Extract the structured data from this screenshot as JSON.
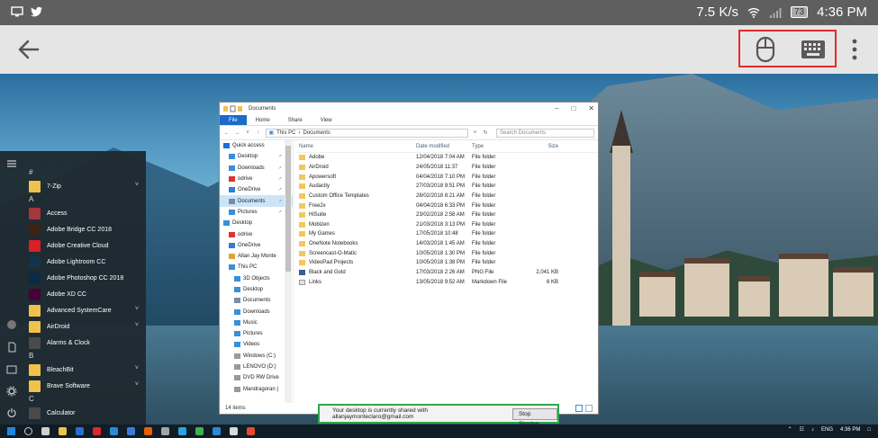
{
  "status_bar": {
    "speed": "7.5 K/s",
    "battery": "73",
    "time": "4:36 PM",
    "icons": [
      "screen-icon",
      "twitter-icon",
      "wifi-icon",
      "signal-icon",
      "battery-icon"
    ]
  },
  "app_bar": {
    "icons": [
      "back-arrow-icon",
      "mouse-icon",
      "keyboard-icon",
      "more-vert-icon"
    ],
    "highlight_color": "#e32a2a"
  },
  "start_menu": {
    "sections": [
      {
        "letter": "#",
        "items": [
          {
            "label": "7-Zip",
            "tile_color": "#f0c24b",
            "has_chevron": true
          }
        ]
      },
      {
        "letter": "A",
        "items": [
          {
            "label": "Access",
            "tile_color": "#a4373a",
            "has_chevron": false
          },
          {
            "label": "Adobe Bridge CC 2018",
            "tile_color": "#3b2414",
            "has_chevron": false
          },
          {
            "label": "Adobe Creative Cloud",
            "tile_color": "#da1f26",
            "has_chevron": false
          },
          {
            "label": "Adobe Lightroom CC",
            "tile_color": "#14324a",
            "has_chevron": false
          },
          {
            "label": "Adobe Photoshop CC 2018",
            "tile_color": "#0c2a45",
            "has_chevron": false
          },
          {
            "label": "Adobe XD CC",
            "tile_color": "#470137",
            "has_chevron": false
          },
          {
            "label": "Advanced SystemCare",
            "tile_color": "#f0c24b",
            "has_chevron": true
          },
          {
            "label": "AirDroid",
            "tile_color": "#f0c24b",
            "has_chevron": true
          },
          {
            "label": "Alarms & Clock",
            "tile_color": "#4a4a4a",
            "has_chevron": false
          }
        ]
      },
      {
        "letter": "B",
        "items": [
          {
            "label": "BleachBit",
            "tile_color": "#f0c24b",
            "has_chevron": true
          },
          {
            "label": "Brave Software",
            "tile_color": "#f0c24b",
            "has_chevron": true
          }
        ]
      },
      {
        "letter": "C",
        "items": [
          {
            "label": "Calculator",
            "tile_color": "#4a4a4a",
            "has_chevron": false
          }
        ]
      }
    ]
  },
  "explorer": {
    "title": "Documents",
    "ribbon_tabs": [
      "File",
      "Home",
      "Share",
      "View"
    ],
    "breadcrumb": [
      "This PC",
      "Documents"
    ],
    "search_placeholder": "Search Documents",
    "nav_items": [
      {
        "label": "Quick access",
        "icon": "star-icon",
        "color": "#1e6fd9",
        "indent": 0,
        "pinned": false
      },
      {
        "label": "Desktop",
        "icon": "folder-icon",
        "color": "#3a8fd8",
        "indent": 1,
        "pinned": true
      },
      {
        "label": "Downloads",
        "icon": "download-icon",
        "color": "#3a8fd8",
        "indent": 1,
        "pinned": true
      },
      {
        "label": "odrive",
        "icon": "cloud-icon",
        "color": "#d33",
        "indent": 1,
        "pinned": true
      },
      {
        "label": "OneDrive",
        "icon": "cloud-icon",
        "color": "#2f7ed8",
        "indent": 1,
        "pinned": true
      },
      {
        "label": "Documents",
        "icon": "document-icon",
        "color": "#7a8ca0",
        "indent": 1,
        "pinned": true
      },
      {
        "label": "Pictures",
        "icon": "picture-icon",
        "color": "#3a8fd8",
        "indent": 1,
        "pinned": true
      },
      {
        "label": "Desktop",
        "icon": "folder-icon",
        "color": "#3a8fd8",
        "indent": 0,
        "pinned": false
      },
      {
        "label": "odrive",
        "icon": "cloud-icon",
        "color": "#d33",
        "indent": 1,
        "pinned": false
      },
      {
        "label": "OneDrive",
        "icon": "cloud-icon",
        "color": "#2f7ed8",
        "indent": 1,
        "pinned": false
      },
      {
        "label": "Allan Jay Monte",
        "icon": "user-icon",
        "color": "#e1a23a",
        "indent": 1,
        "pinned": false
      },
      {
        "label": "This PC",
        "icon": "computer-icon",
        "color": "#3a8fd8",
        "indent": 1,
        "pinned": false
      },
      {
        "label": "3D Objects",
        "icon": "cube-icon",
        "color": "#3a8fd8",
        "indent": 2,
        "pinned": false
      },
      {
        "label": "Desktop",
        "icon": "folder-icon",
        "color": "#3a8fd8",
        "indent": 2,
        "pinned": false
      },
      {
        "label": "Documents",
        "icon": "document-icon",
        "color": "#7a8ca0",
        "indent": 2,
        "pinned": false
      },
      {
        "label": "Downloads",
        "icon": "download-icon",
        "color": "#3a8fd8",
        "indent": 2,
        "pinned": false
      },
      {
        "label": "Music",
        "icon": "music-icon",
        "color": "#3a8fd8",
        "indent": 2,
        "pinned": false
      },
      {
        "label": "Pictures",
        "icon": "picture-icon",
        "color": "#3a8fd8",
        "indent": 2,
        "pinned": false
      },
      {
        "label": "Videos",
        "icon": "video-icon",
        "color": "#3a8fd8",
        "indent": 2,
        "pinned": false
      },
      {
        "label": "Windows (C:)",
        "icon": "drive-icon",
        "color": "#999",
        "indent": 2,
        "pinned": false
      },
      {
        "label": "LENOVO (D:)",
        "icon": "drive-icon",
        "color": "#999",
        "indent": 2,
        "pinned": false
      },
      {
        "label": "DVD RW Drive",
        "icon": "disc-icon",
        "color": "#999",
        "indent": 2,
        "pinned": false
      },
      {
        "label": "Mandragoran (",
        "icon": "drive-icon",
        "color": "#999",
        "indent": 2,
        "pinned": false
      }
    ],
    "columns": [
      "Name",
      "Date modified",
      "Type",
      "Size"
    ],
    "files": [
      {
        "name": "Adobe",
        "date": "12/04/2018 7:04 AM",
        "type": "File folder",
        "size": "",
        "icon": "folder-icon"
      },
      {
        "name": "AirDroid",
        "date": "24/05/2018 11:37",
        "type": "File folder",
        "size": "",
        "icon": "folder-icon"
      },
      {
        "name": "Apowersoft",
        "date": "04/04/2018 7:10 PM",
        "type": "File folder",
        "size": "",
        "icon": "folder-icon"
      },
      {
        "name": "Audacity",
        "date": "27/03/2018 9:51 PM",
        "type": "File folder",
        "size": "",
        "icon": "folder-icon"
      },
      {
        "name": "Custom Office Templates",
        "date": "28/02/2018 8:21 AM",
        "type": "File folder",
        "size": "",
        "icon": "folder-icon"
      },
      {
        "name": "Free2x",
        "date": "04/04/2018 6:33 PM",
        "type": "File folder",
        "size": "",
        "icon": "folder-icon"
      },
      {
        "name": "HiSuite",
        "date": "23/02/2018 2:58 AM",
        "type": "File folder",
        "size": "",
        "icon": "folder-icon"
      },
      {
        "name": "Mobizen",
        "date": "21/03/2018 3:13 PM",
        "type": "File folder",
        "size": "",
        "icon": "folder-icon"
      },
      {
        "name": "My Games",
        "date": "17/05/2018 10:48",
        "type": "File folder",
        "size": "",
        "icon": "folder-icon"
      },
      {
        "name": "OneNote Notebooks",
        "date": "14/03/2018 1:45 AM",
        "type": "File folder",
        "size": "",
        "icon": "folder-icon"
      },
      {
        "name": "Screencast-O-Matic",
        "date": "10/05/2018 1:30 PM",
        "type": "File folder",
        "size": "",
        "icon": "folder-icon"
      },
      {
        "name": "VideoPad Projects",
        "date": "10/05/2018 1:38 PM",
        "type": "File folder",
        "size": "",
        "icon": "folder-icon"
      },
      {
        "name": "Black and Gold",
        "date": "17/03/2018 2:26 AM",
        "type": "PNG File",
        "size": "2,041 KB",
        "icon": "image-file-icon"
      },
      {
        "name": "Links",
        "date": "13/05/2018 9:52 AM",
        "type": "Markdown File",
        "size": "6 KB",
        "icon": "text-file-icon"
      }
    ],
    "item_count": "14 items"
  },
  "share_bar": {
    "message": "Your desktop is currently shared with allanjaymonteclaro@gmail.com",
    "stop_label": "Stop Sharing",
    "border_color": "#2da84a"
  },
  "taskbar": {
    "apps": [
      {
        "icon": "windows-start-icon",
        "color": "#1f86e0"
      },
      {
        "icon": "search-icon",
        "color": "#d0d0d0"
      },
      {
        "icon": "task-view-icon",
        "color": "#d0d0d0"
      },
      {
        "icon": "file-explorer-icon",
        "color": "#f0c24b"
      },
      {
        "icon": "app-icon",
        "color": "#2a6fc9"
      },
      {
        "icon": "opera-icon",
        "color": "#e0262f"
      },
      {
        "icon": "app-icon",
        "color": "#2a8ad8"
      },
      {
        "icon": "app-icon",
        "color": "#3a7bd5"
      },
      {
        "icon": "firefox-icon",
        "color": "#e66000"
      },
      {
        "icon": "app-icon",
        "color": "#a4a4a4"
      },
      {
        "icon": "app-icon",
        "color": "#2aa4e0"
      },
      {
        "icon": "app-icon",
        "color": "#3fb24f"
      },
      {
        "icon": "app-icon",
        "color": "#2d88d8"
      },
      {
        "icon": "app-icon",
        "color": "#d8d8d8"
      },
      {
        "icon": "app-icon",
        "color": "#e34b2f"
      }
    ],
    "lang": "ENG",
    "time": "4:36 PM"
  }
}
